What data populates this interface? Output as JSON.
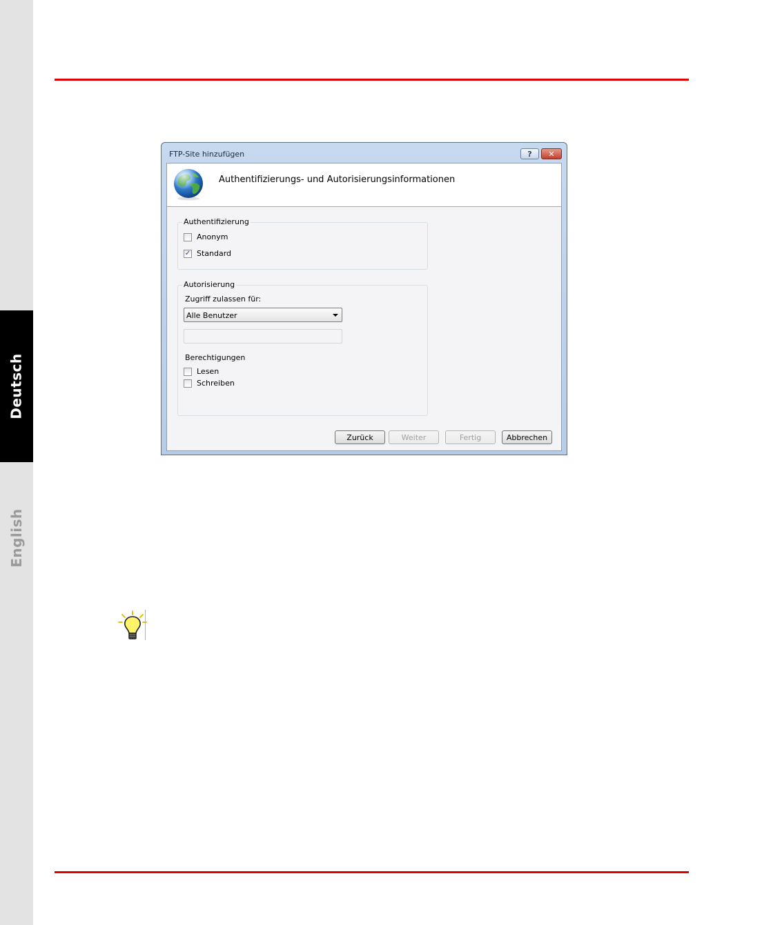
{
  "side_tabs": {
    "deutsch": "Deutsch",
    "english": "English"
  },
  "dialog": {
    "title": "FTP-Site hinzufügen",
    "help_label": "?",
    "close_label": "✕",
    "header_title": "Authentifizierungs- und Autorisierungsinformationen",
    "authentication": {
      "legend": "Authentifizierung",
      "anonymous": {
        "label": "Anonym",
        "checked": false
      },
      "standard": {
        "label": "Standard",
        "checked": true
      }
    },
    "authorization": {
      "legend": "Autorisierung",
      "access_label": "Zugriff zulassen für:",
      "access_selected": "Alle Benutzer",
      "access_text_value": "",
      "permissions_label": "Berechtigungen",
      "read": {
        "label": "Lesen",
        "checked": false
      },
      "write": {
        "label": "Schreiben",
        "checked": false
      }
    },
    "buttons": {
      "back": "Zurück",
      "next": "Weiter",
      "finish": "Fertig",
      "cancel": "Abbrechen"
    }
  },
  "colors": {
    "accent_rule": "#e00000",
    "active_tab": "#000000",
    "side_strip": "#e3e3e3"
  },
  "icons": {
    "globe": "globe-icon",
    "tip": "lightbulb-icon"
  }
}
